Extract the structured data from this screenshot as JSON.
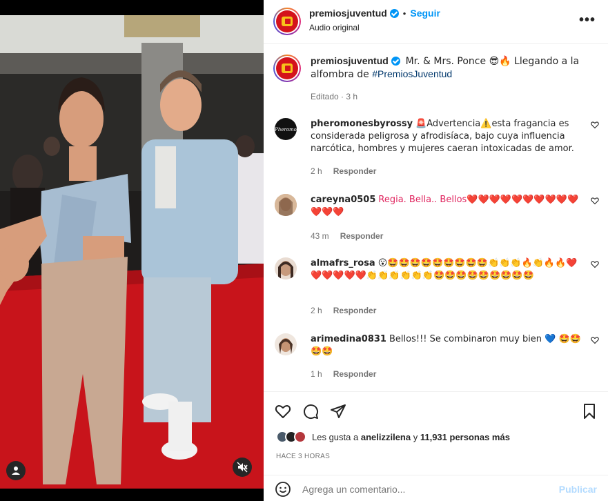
{
  "header": {
    "username": "premiosjuventud",
    "follow_label": "Seguir",
    "audio_label": "Audio original",
    "more_label": "•••"
  },
  "caption": {
    "username": "premiosjuventud",
    "text": "Mr. & Mrs. Ponce 😎🔥 Llegando a la alfombra de ",
    "hashtag": "#PremiosJuventud",
    "meta": "Editado · 3 h"
  },
  "comments": [
    {
      "username": "pheromonesbyrossy",
      "text": "🚨Advertencia⚠️esta fragancia es considerada peligrosa y afrodisíaca, bajo cuya influencia narcótica, hombres y mujeres caeran intoxicadas de amor.",
      "time": "2 h",
      "reply": "Responder",
      "avatar_color": "#111111"
    },
    {
      "username": "careyna0505",
      "text": "Regia. Bella.. Bellos❤️❤️❤️❤️❤️❤️❤️❤️❤️❤️❤️❤️❤️",
      "time": "43 m",
      "reply": "Responder",
      "avatar_color": "#c9a07c"
    },
    {
      "username": "almafrs_rosa",
      "text": "😮🤩🤩🤩🤩🤩🤩🤩🤩🤩👏👏👏🔥👏🔥🔥❤️❤️❤️❤️❤️❤️👏👏👏👏👏👏🤩🤩🤩🤩🤩🤩🤩🤩🤩",
      "time": "2 h",
      "reply": "Responder",
      "avatar_color": "#6b4a3a"
    },
    {
      "username": "arimedina0831",
      "text": "Bellos!!! Se combinaron muy bien 💙 🤩🤩🤩🤩",
      "time": "1 h",
      "reply": "Responder",
      "avatar_color": "#8a6b55"
    }
  ],
  "likes": {
    "prefix": "Les gusta a ",
    "user": "anelizzilena",
    "mid": " y ",
    "count": "11,931 personas más"
  },
  "ago": "HACE 3 HORAS",
  "comment_box": {
    "placeholder": "Agrega un comentario...",
    "post_label": "Publicar"
  },
  "colors": {
    "accent": "#0095f6",
    "brand_red": "#d4131c",
    "brand_yellow": "#f7c21b",
    "suit": "#aac4d8",
    "carpet": "#c8141b"
  }
}
